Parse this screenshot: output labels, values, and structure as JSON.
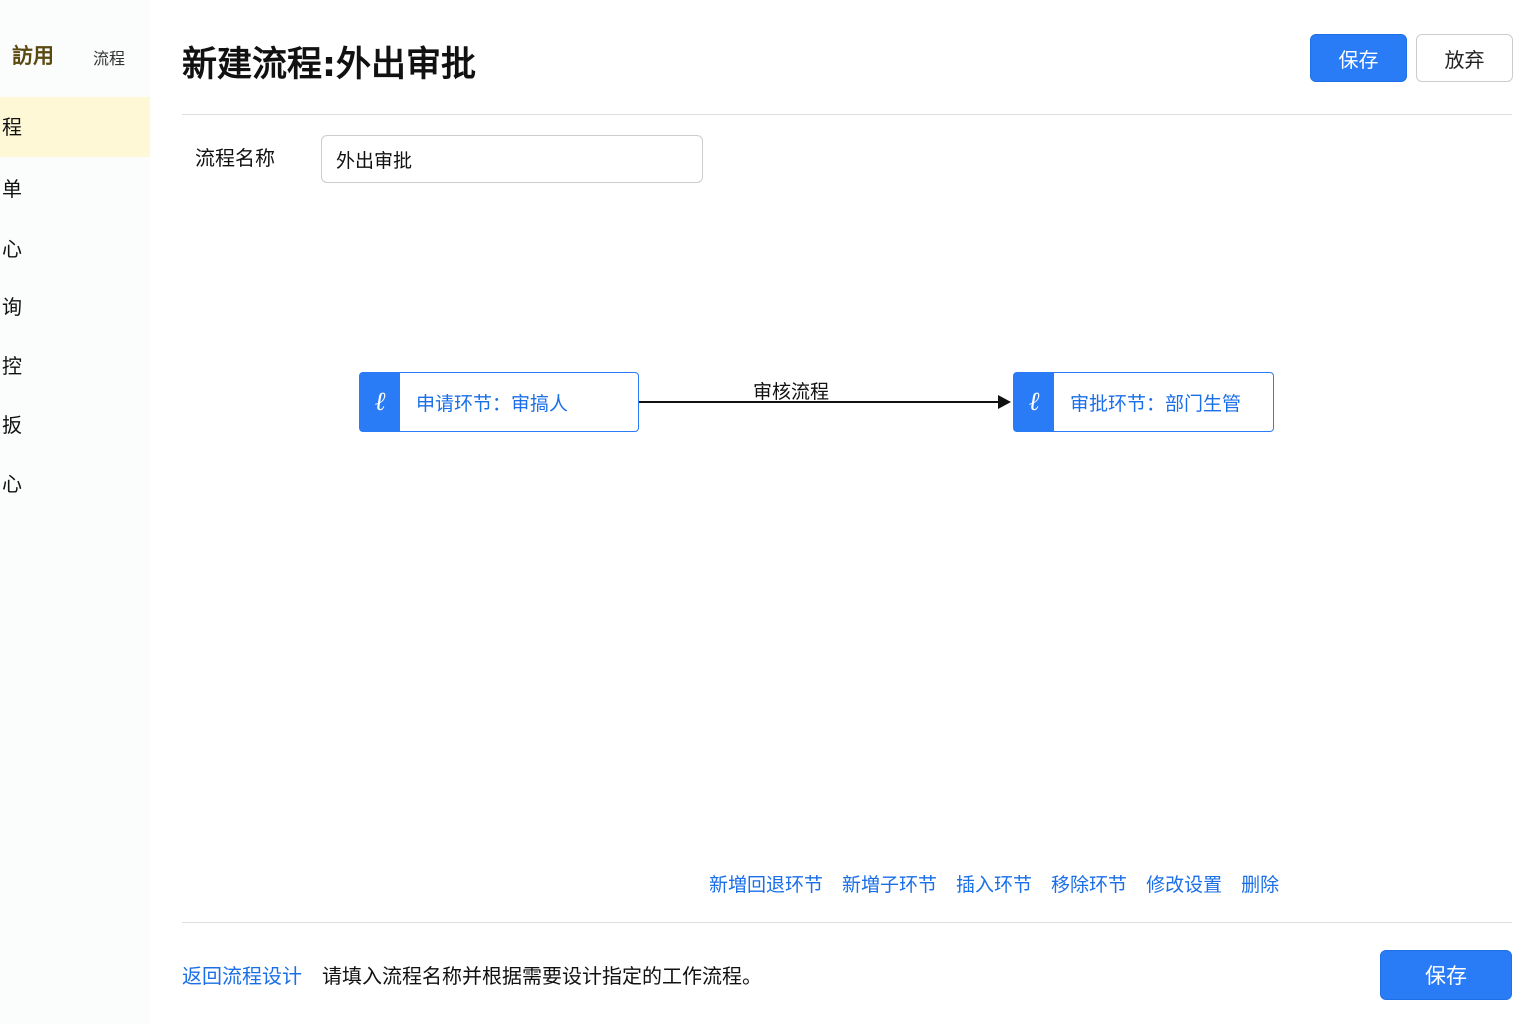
{
  "sidebar": {
    "header": "訪用",
    "header_tab": "流程",
    "items": [
      {
        "label": "程",
        "active": true
      },
      {
        "label": "单"
      },
      {
        "label": "心"
      },
      {
        "label": "询"
      },
      {
        "label": "控"
      },
      {
        "label": "扳"
      },
      {
        "label": "心"
      }
    ]
  },
  "header": {
    "title": "新建流程:外出审批",
    "save_label": "保存",
    "discard_label": "放弃"
  },
  "form": {
    "name_label": "流程名称",
    "name_value": "外出审批"
  },
  "diagram": {
    "nodes": [
      {
        "icon": "signature-icon",
        "label": "申请环节：审搞人"
      },
      {
        "icon": "signature-icon",
        "label": "审批环节：部门生管"
      }
    ],
    "edge_label": "审核流程"
  },
  "actions": [
    "新増回退环节",
    "新増子环节",
    "插入环节",
    "移除环节",
    "修改设置",
    "删除"
  ],
  "footer": {
    "back_label": "返回流程设计",
    "hint": "请填入流程名称并根据需要设计指定的工作流程。",
    "save_label": "保存"
  },
  "colors": {
    "accent": "#2a7cf6",
    "active_bg": "#fff8d6"
  }
}
